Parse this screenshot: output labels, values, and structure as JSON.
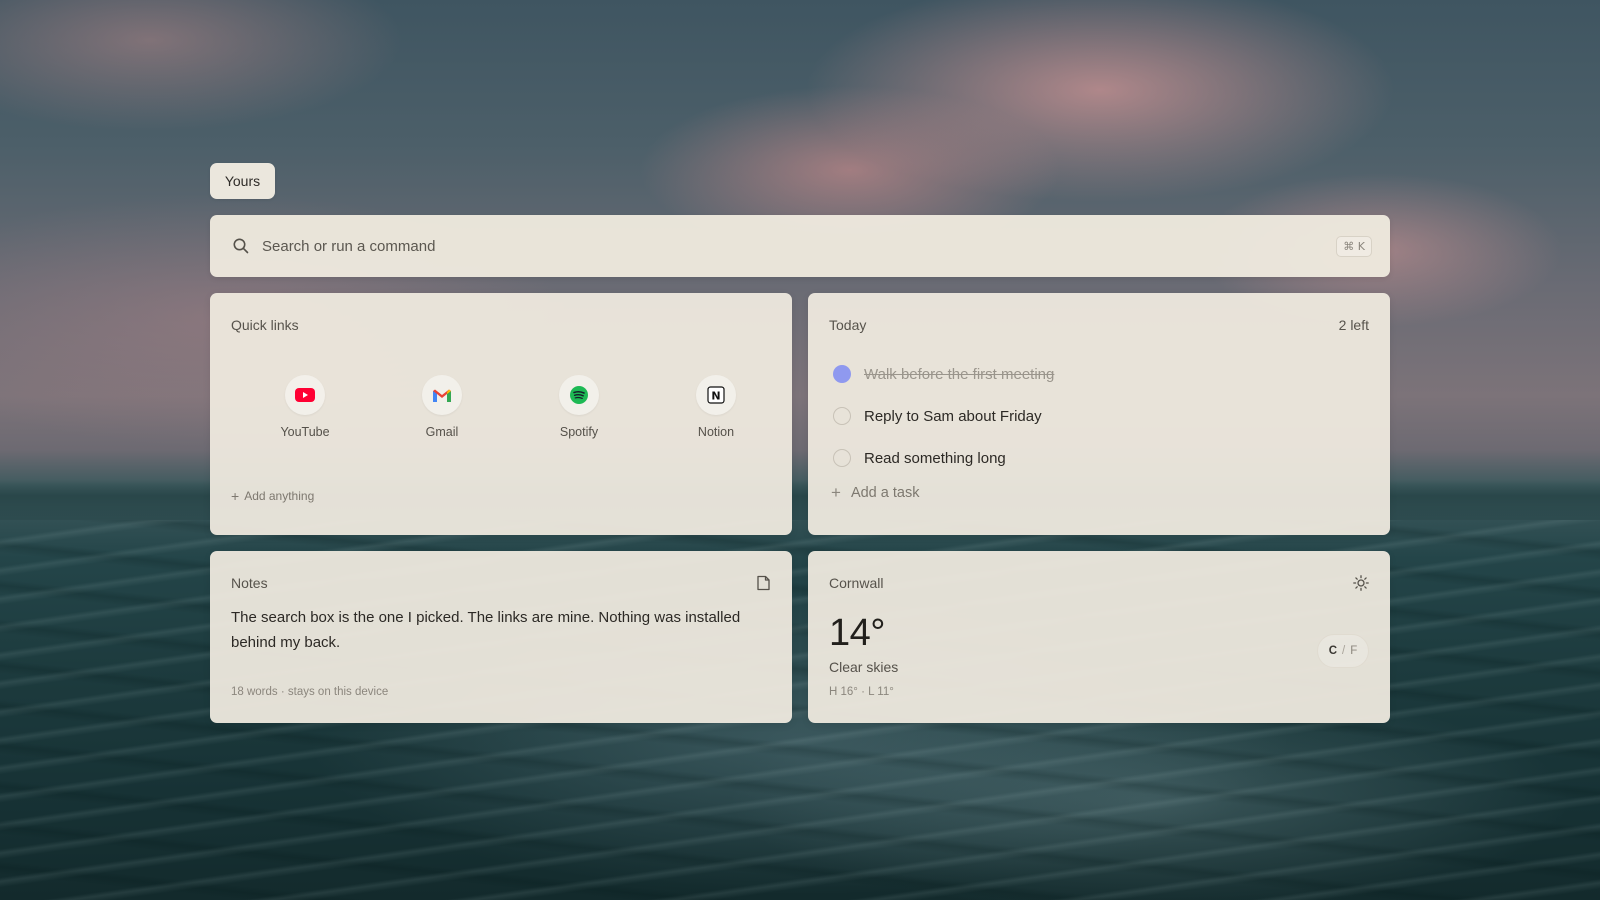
{
  "tab": {
    "label": "Yours"
  },
  "search": {
    "placeholder": "Search or run a command",
    "shortcut": "⌘ K"
  },
  "quick_links": {
    "title": "Quick links",
    "items": [
      {
        "label": "YouTube",
        "icon": "youtube-icon",
        "color": "#ff0033"
      },
      {
        "label": "Gmail",
        "icon": "gmail-icon",
        "color": "#ea4335"
      },
      {
        "label": "Spotify",
        "icon": "spotify-icon",
        "color": "#1db954"
      },
      {
        "label": "Notion",
        "icon": "notion-icon",
        "color": "#111111"
      }
    ],
    "add_label": "Add anything"
  },
  "today": {
    "title": "Today",
    "remaining": "2 left",
    "tasks": [
      {
        "label": "Walk before the first meeting",
        "done": true
      },
      {
        "label": "Reply to Sam about Friday",
        "done": false
      },
      {
        "label": "Read something long",
        "done": false
      }
    ],
    "add_label": "Add a task",
    "accent_color": "#8f99ef"
  },
  "notes": {
    "title": "Notes",
    "body": "The search box is the one I picked. The links are mine. Nothing was installed behind my back.",
    "meta": "18 words · stays on this device"
  },
  "weather": {
    "location": "Cornwall",
    "temperature": "14°",
    "condition": "Clear skies",
    "hi_lo": "H 16° · L 11°",
    "unit_celsius": "C",
    "unit_separator": "/",
    "unit_fahrenheit": "F"
  }
}
